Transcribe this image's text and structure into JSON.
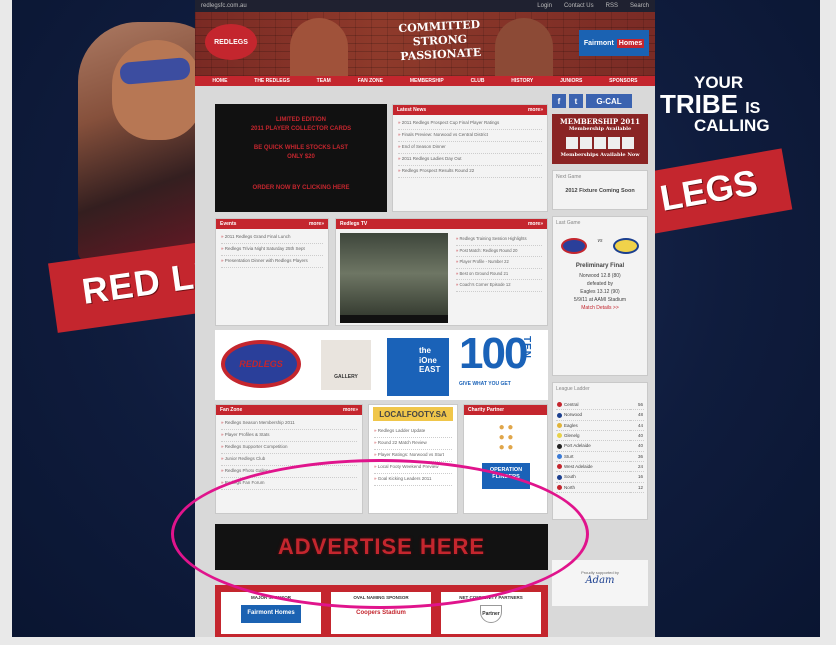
{
  "topbar": {
    "site": "redlegsfc.com.au",
    "links": [
      "Login",
      "Contact Us",
      "RSS",
      "Search"
    ]
  },
  "header": {
    "logo_text": "REDLEGS",
    "tagline": [
      "COMMITTED",
      "STRONG",
      "PASSIONATE"
    ],
    "sponsor": {
      "part1": "Fairmont",
      "part2": "Homes"
    }
  },
  "nav": [
    "HOME",
    "THE REDLEGS",
    "TEAM",
    "FAN ZONE",
    "MEMBERSHIP",
    "CLUB",
    "HISTORY",
    "JUNIORS",
    "SPONSORS"
  ],
  "background": {
    "tribe1": "YOUR",
    "tribe2": "TRIBE",
    "tribe2b": "IS",
    "tribe3": "CALLING",
    "redlegs": "RED LE",
    "legs": "LEGS"
  },
  "feature": {
    "line1": "LIMITED EDITION",
    "line2": "2011 PLAYER COLLECTOR CARDS",
    "line3": "BE QUICK WHILE STOCKS LAST",
    "line4": "ONLY $20",
    "button": "ORDER NOW BY CLICKING HERE"
  },
  "latest_news": {
    "title": "Latest News",
    "more": "more»",
    "items": [
      "2011 Redlegs Prospect Cup Final Player Ratings",
      "Finals Preview: Norwood vs Central District",
      "End of Season Dinner",
      "2011 Redlegs Ladies Day Out",
      "Redlegs Prospect Results Round 22"
    ]
  },
  "events": {
    "title": "Events",
    "more": "more»",
    "items": [
      "2011 Redlegs Grand Final Lunch",
      "Redlegs Trivia Night Saturday 25th Sept",
      "Presentation Dinner with Redlegs Players"
    ]
  },
  "tv": {
    "title": "Redlegs TV",
    "more": "more»",
    "items": [
      "Redlegs Training Session Highlights",
      "Post Match: Redlegs Round 20",
      "Player Profile - Number 22",
      "Best on Ground Round 21",
      "Coach's Corner Episode 12"
    ]
  },
  "sponsors_row": {
    "logo1": "REDLEGS",
    "gallery": "GALLERY",
    "ione_line1": "the",
    "ione_line2": "iOne",
    "ione_line3": "EAST",
    "hundred": "100",
    "ten": "TEN",
    "give": "GIVE WHAT YOU GET"
  },
  "fanzone": {
    "title": "Fan Zone",
    "more": "more»",
    "items": [
      "Redlegs Season Membership 2011",
      "Player Profiles & Stats",
      "Redlegs Supporter Competition",
      "Junior Redlegs Club",
      "Redlegs Photo Gallery",
      "Redlegs Fan Forum"
    ]
  },
  "localfooty": {
    "logo": "LOCALFOOTY.SA",
    "items": [
      "Redlegs Ladder Update",
      "Round 22 Match Review",
      "Player Ratings: Norwood vs Sturt",
      "Local Footy Weekend Preview",
      "Goal Kicking Leaders 2011"
    ]
  },
  "charity": {
    "title": "Charity Partner",
    "logo_line1": "OPERATION",
    "logo_line2": "FLINDERS"
  },
  "advert": {
    "text": "ADVERTISE HERE"
  },
  "footer_sponsors": [
    {
      "title": "MAJOR SPONSOR",
      "label": "Fairmont Homes"
    },
    {
      "title": "OVAL NAMING SPONSOR",
      "label": "Coopers Stadium"
    },
    {
      "title": "NET COMMUNITY PARTNERS",
      "label": "Partner"
    }
  ],
  "sidebar": {
    "social": [
      "f",
      "t",
      "G-CAL"
    ],
    "membership": {
      "line1": "MEMBERSHIP 2011",
      "line2": "Membership Available",
      "line3": "Memberships Available Now"
    },
    "next_game": {
      "label": "Next Game",
      "title": "2012 Fixture Coming Soon"
    },
    "last_game": {
      "label": "Last Game",
      "vs": "vs",
      "title": "Preliminary Final",
      "line1": "Norwood 12.8 (80)",
      "line2": "defeated by",
      "line3": "Eagles 13.12 (90)",
      "line4": "5/9/11 at AAMI Stadium",
      "link": "Match Details >>"
    },
    "ladder": {
      "label": "League Ladder",
      "rows": [
        {
          "team": "Central",
          "pts": "56",
          "color": "#c4262e"
        },
        {
          "team": "Norwood",
          "pts": "48",
          "color": "#1b3f8f"
        },
        {
          "team": "Eagles",
          "pts": "44",
          "color": "#e0b43a"
        },
        {
          "team": "Glenelg",
          "pts": "40",
          "color": "#e8d248"
        },
        {
          "team": "Port Adelaide",
          "pts": "40",
          "color": "#222222"
        },
        {
          "team": "Sturt",
          "pts": "36",
          "color": "#3a7ad6"
        },
        {
          "team": "West Adelaide",
          "pts": "24",
          "color": "#c4262e"
        },
        {
          "team": "South",
          "pts": "16",
          "color": "#1b3f8f"
        },
        {
          "team": "North",
          "pts": "12",
          "color": "#c4262e"
        }
      ]
    },
    "adam": {
      "name": "Adam",
      "sub": "Proudly supported by"
    }
  },
  "colors": {
    "brand_red": "#c4262e",
    "navy": "#0f1c3d",
    "highlight": "#e0148c"
  }
}
